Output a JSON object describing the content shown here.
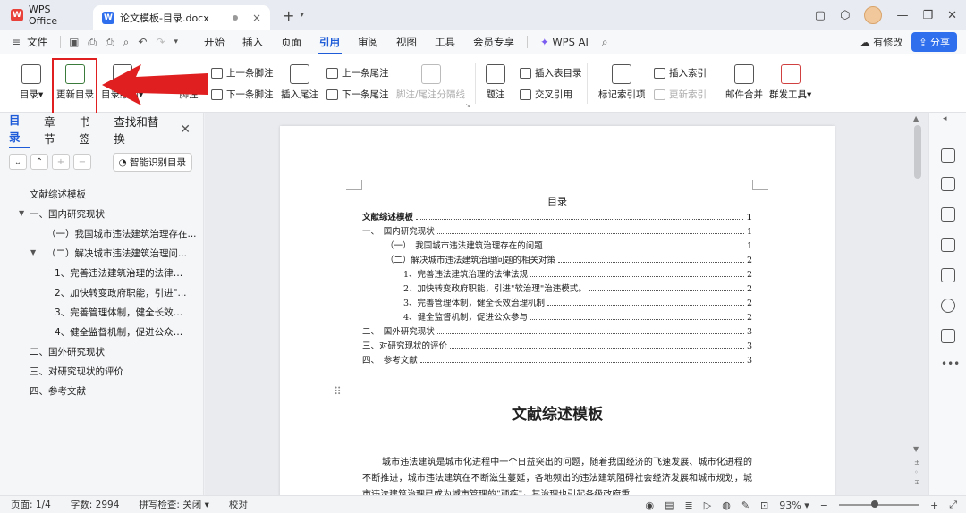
{
  "titlebar": {
    "app_tab": "WPS Office",
    "doc_tab": "论文模板-目录.docx"
  },
  "menubar": {
    "file": "文件",
    "tabs": [
      "开始",
      "插入",
      "页面",
      "引用",
      "审阅",
      "视图",
      "工具",
      "会员专享"
    ],
    "active_tab": "引用",
    "wps_ai": "WPS AI",
    "has_modified": "有修改",
    "share": "分享"
  },
  "ribbon": {
    "toc": "目录",
    "update_toc": "更新目录",
    "toc_level": "目录级别",
    "footnote": "脚注",
    "prev_footnote": "上一条脚注",
    "next_footnote": "下一条脚注",
    "insert_endnote": "插入尾注",
    "prev_endnote": "上一条尾注",
    "next_endnote": "下一条尾注",
    "footnote_separator": "脚注/尾注分隔线",
    "caption": "题注",
    "insert_table_of_figures": "插入表目录",
    "cross_reference": "交叉引用",
    "mark_index_entry": "标记索引项",
    "insert_index": "插入索引",
    "update_index": "更新索引",
    "mail_merge": "邮件合并",
    "group_send": "群发工具"
  },
  "leftpanel": {
    "tabs": [
      "目录",
      "章节",
      "书签",
      "查找和替换"
    ],
    "smart_button": "智能识别目录",
    "items": [
      "文献综述模板",
      "一、国内研究现状",
      "（一）我国城市违法建筑治理存在...",
      "（二）解决城市违法建筑治理问...",
      "1、完善违法建筑治理的法律法...",
      "2、加快转变政府职能，引进\"...",
      "3、完善管理体制，健全长效治...",
      "4、健全监督机制，促进公众参...",
      "二、国外研究现状",
      "三、对研究现状的评价",
      "四、参考文献"
    ]
  },
  "document": {
    "toc_heading": "目录",
    "toc_entries": [
      {
        "text": "文献综述模板",
        "page": "1"
      },
      {
        "text": "一、　国内研究现状",
        "page": "1"
      },
      {
        "text": "（一）　我国城市违法建筑治理存在的问题",
        "page": "1"
      },
      {
        "text": "（二）解决城市违法建筑治理问题的相关对策",
        "page": "2"
      },
      {
        "text": "1、完善违法建筑治理的法律法规",
        "page": "2"
      },
      {
        "text": "2、加快转变政府职能，引进\"软治理\"治违模式。",
        "page": "2"
      },
      {
        "text": "3、完善管理体制，健全长效治理机制",
        "page": "2"
      },
      {
        "text": "4、健全监督机制，促进公众参与",
        "page": "2"
      },
      {
        "text": "二、　国外研究现状",
        "page": "3"
      },
      {
        "text": "三、对研究现状的评价",
        "page": "3"
      },
      {
        "text": "四、　参考文献",
        "page": "3"
      }
    ],
    "title": "文献综述模板",
    "paragraph": "城市违法建筑是城市化进程中一个日益突出的问题，随着我国经济的飞速发展、城市化进程的不断推进，城市违法建筑在不断滋生蔓延，各地频出的违法建筑阻碍社会经济发展和城市规划，城市违法建筑治理已成为城市管理的\"顽疾\"，其治理也引起各级政府重"
  },
  "statusbar": {
    "page": "页面: 1/4",
    "words": "字数: 2994",
    "spellcheck": "拼写检查: 关闭",
    "proofread": "校对",
    "zoom": "93%",
    "zoom_level": 0.93
  }
}
